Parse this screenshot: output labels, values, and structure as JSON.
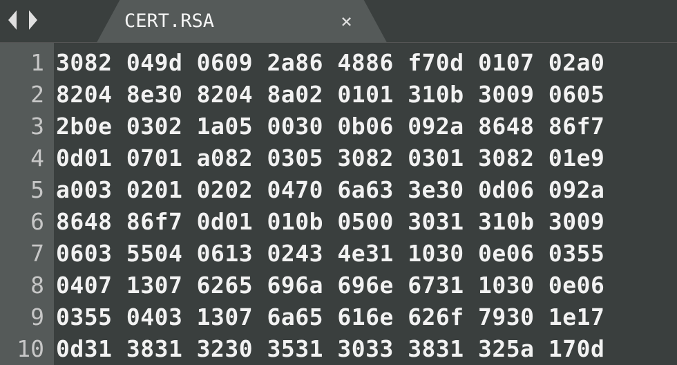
{
  "tab": {
    "title": "CERT.RSA",
    "close_label": "×"
  },
  "icons": {
    "prev": "chevron-left-icon",
    "next": "chevron-right-icon",
    "close": "close-icon"
  },
  "lines": [
    "3082 049d 0609 2a86 4886 f70d 0107 02a0",
    "8204 8e30 8204 8a02 0101 310b 3009 0605",
    "2b0e 0302 1a05 0030 0b06 092a 8648 86f7",
    "0d01 0701 a082 0305 3082 0301 3082 01e9",
    "a003 0201 0202 0470 6a63 3e30 0d06 092a",
    "8648 86f7 0d01 010b 0500 3031 310b 3009",
    "0603 5504 0613 0243 4e31 1030 0e06 0355",
    "0407 1307 6265 696a 696e 6731 1030 0e06",
    "0355 0403 1307 6a65 616e 626f 7930 1e17",
    "0d31 3831 3230 3531 3033 3831 325a 170d"
  ]
}
